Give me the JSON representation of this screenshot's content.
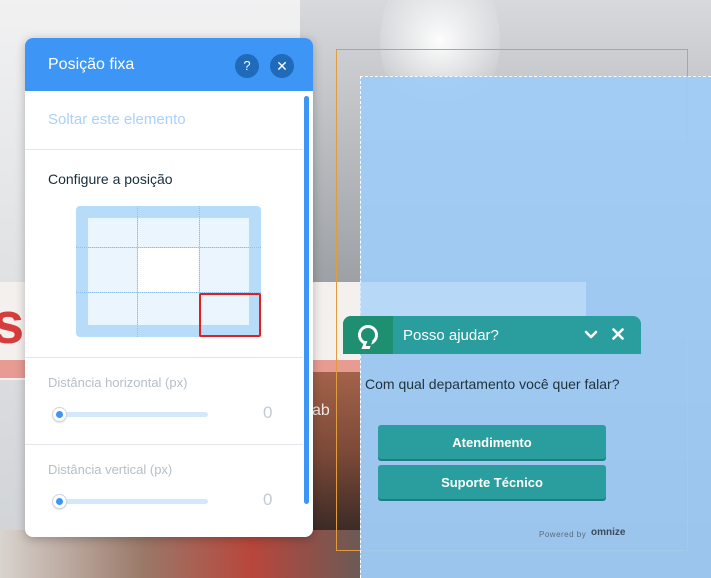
{
  "background": {
    "banner_letter": "s",
    "sign_fragment": "ab"
  },
  "panel": {
    "title": "Posição fixa",
    "help_label": "?",
    "close_label": "✕",
    "detach_link": "Soltar este elemento",
    "config_label": "Configure a posição",
    "position_grid": {
      "rows": 3,
      "cols": 3,
      "selected": "bottom-right"
    },
    "horizontal_distance": {
      "label": "Distância horizontal (px)",
      "value": "0"
    },
    "vertical_distance": {
      "label": "Distância vertical (px)",
      "value": "0"
    }
  },
  "chat": {
    "title": "Posso ajudar?",
    "minimize_icon": "⌄",
    "close_icon": "✕",
    "question": "Com qual departamento você quer falar?",
    "buttons": [
      "Atendimento",
      "Suporte Técnico"
    ],
    "powered_by": "Powered by",
    "brand": "omnize"
  },
  "colors": {
    "panel_header": "#3d96f5",
    "chat_header": "#2a9d9e",
    "chat_logo_bg": "#1f8f72",
    "selection_fill": "#a0ccf8",
    "selection_outline": "#e29c3b",
    "grid_selected": "#e02020"
  }
}
